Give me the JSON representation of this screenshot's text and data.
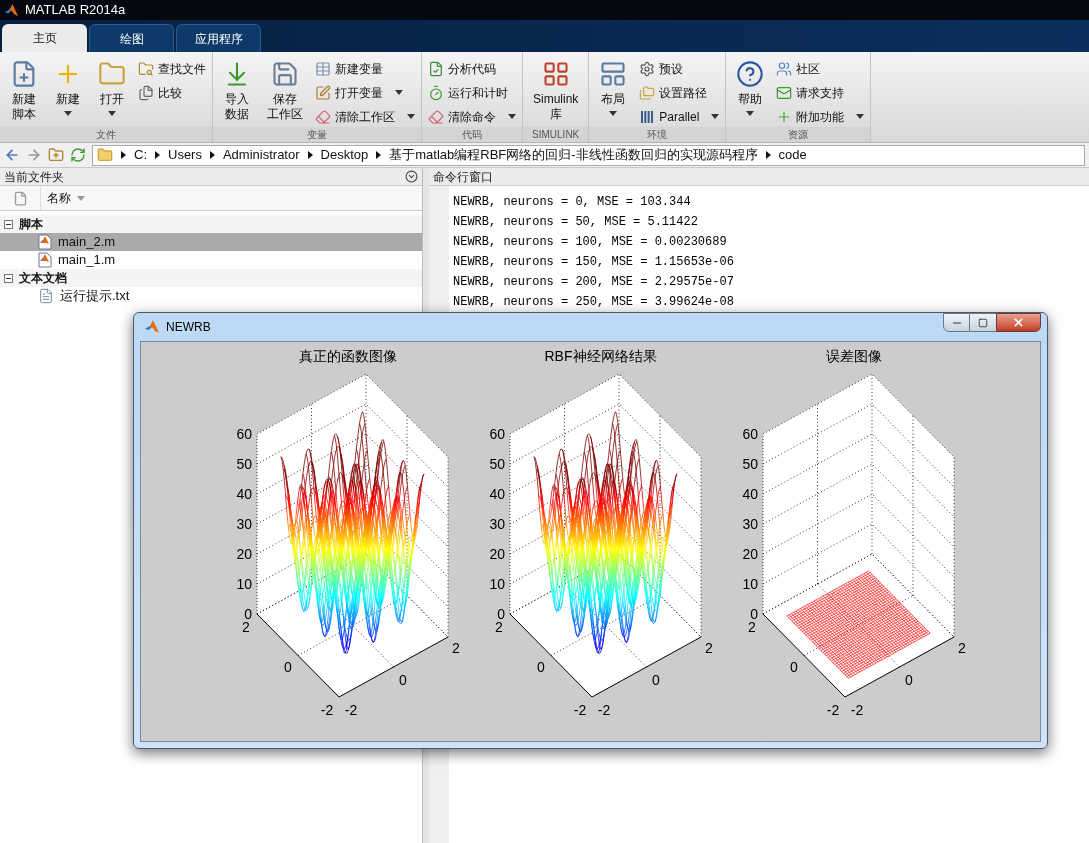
{
  "window": {
    "title": "MATLAB R2014a"
  },
  "tabs": [
    {
      "label": "主页",
      "selected": true
    },
    {
      "label": "绘图",
      "selected": false
    },
    {
      "label": "应用程序",
      "selected": false
    }
  ],
  "ribbon": {
    "sections": [
      {
        "label": "文件",
        "items": [
          {
            "kind": "large",
            "lines": [
              "新建",
              "脚本"
            ],
            "dropdown": false
          },
          {
            "kind": "large",
            "lines": [
              "新建"
            ],
            "dropdown": true
          },
          {
            "kind": "large",
            "lines": [
              "打开"
            ],
            "dropdown": true
          },
          {
            "kind": "stack",
            "entries": [
              {
                "label": "查找文件",
                "dropdown": false
              },
              {
                "label": "比较",
                "dropdown": false
              }
            ]
          }
        ]
      },
      {
        "label": "变量",
        "items": [
          {
            "kind": "large",
            "lines": [
              "导入",
              "数据"
            ],
            "dropdown": false
          },
          {
            "kind": "large",
            "lines": [
              "保存",
              "工作区"
            ],
            "dropdown": false
          },
          {
            "kind": "stack",
            "entries": [
              {
                "label": "新建变量",
                "dropdown": false
              },
              {
                "label": "打开变量",
                "dropdown": true
              },
              {
                "label": "清除工作区",
                "dropdown": true
              }
            ]
          }
        ]
      },
      {
        "label": "代码",
        "items": [
          {
            "kind": "stack",
            "entries": [
              {
                "label": "分析代码",
                "dropdown": false
              },
              {
                "label": "运行和计时",
                "dropdown": false
              },
              {
                "label": "清除命令",
                "dropdown": true
              }
            ]
          }
        ]
      },
      {
        "label": "SIMULINK",
        "items": [
          {
            "kind": "large",
            "lines": [
              "Simulink",
              "库"
            ],
            "dropdown": false
          }
        ]
      },
      {
        "label": "环境",
        "items": [
          {
            "kind": "large",
            "lines": [
              "布局"
            ],
            "dropdown": true
          },
          {
            "kind": "stack",
            "entries": [
              {
                "label": "预设",
                "dropdown": false
              },
              {
                "label": "设置路径",
                "dropdown": false
              },
              {
                "label": "Parallel",
                "dropdown": true
              }
            ]
          }
        ]
      },
      {
        "label": "资源",
        "items": [
          {
            "kind": "large",
            "lines": [
              "帮助"
            ],
            "dropdown": true
          },
          {
            "kind": "stack",
            "entries": [
              {
                "label": "社区",
                "dropdown": false
              },
              {
                "label": "请求支持",
                "dropdown": false
              },
              {
                "label": "附加功能",
                "dropdown": true
              }
            ]
          }
        ]
      }
    ]
  },
  "address_bar": {
    "path": [
      "C:",
      "Users",
      "Administrator",
      "Desktop",
      "基于matlab编程RBF网络的回归-非线性函数回归的实现源码程序",
      "code"
    ]
  },
  "current_folder": {
    "title": "当前文件夹",
    "column": "名称",
    "groups": [
      {
        "label": "脚本",
        "expanded": true,
        "children": [
          {
            "label": "main_2.m",
            "kind": "m-file",
            "selected": true
          },
          {
            "label": "main_1.m",
            "kind": "m-file",
            "selected": false
          }
        ]
      },
      {
        "label": "文本文档",
        "expanded": true,
        "children": [
          {
            "label": "运行提示.txt",
            "kind": "text-file",
            "selected": false
          }
        ]
      }
    ]
  },
  "command_window": {
    "title": "命令行窗口",
    "lines": [
      "NEWRB, neurons = 0, MSE = 103.344",
      "NEWRB, neurons = 50, MSE = 5.11422",
      "NEWRB, neurons = 100, MSE = 0.00230689",
      "NEWRB, neurons = 150, MSE = 1.15653e-06",
      "NEWRB, neurons = 200, MSE = 2.29575e-07",
      "NEWRB, neurons = 250, MSE = 3.99624e-08"
    ]
  },
  "figure": {
    "title": "NEWRB",
    "plots": [
      {
        "title": "真正的函数图像",
        "kind": "surface",
        "z_ticks": [
          "60",
          "50",
          "40",
          "30",
          "20",
          "10",
          "0"
        ],
        "y_ticks": [
          "2",
          "0",
          "-2"
        ],
        "x_ticks": [
          "-2",
          "0",
          "2"
        ]
      },
      {
        "title": "RBF神经网络结果",
        "kind": "surface",
        "z_ticks": [
          "60",
          "50",
          "40",
          "30",
          "20",
          "10",
          "0"
        ],
        "y_ticks": [
          "2",
          "0",
          "-2"
        ],
        "x_ticks": [
          "-2",
          "0",
          "2"
        ]
      },
      {
        "title": "误差图像",
        "kind": "flat",
        "z_ticks": [
          "60",
          "50",
          "40",
          "30",
          "20",
          "10",
          "0"
        ],
        "y_ticks": [
          "2",
          "0",
          "-2"
        ],
        "x_ticks": [
          "-2",
          "0",
          "2"
        ]
      }
    ]
  }
}
